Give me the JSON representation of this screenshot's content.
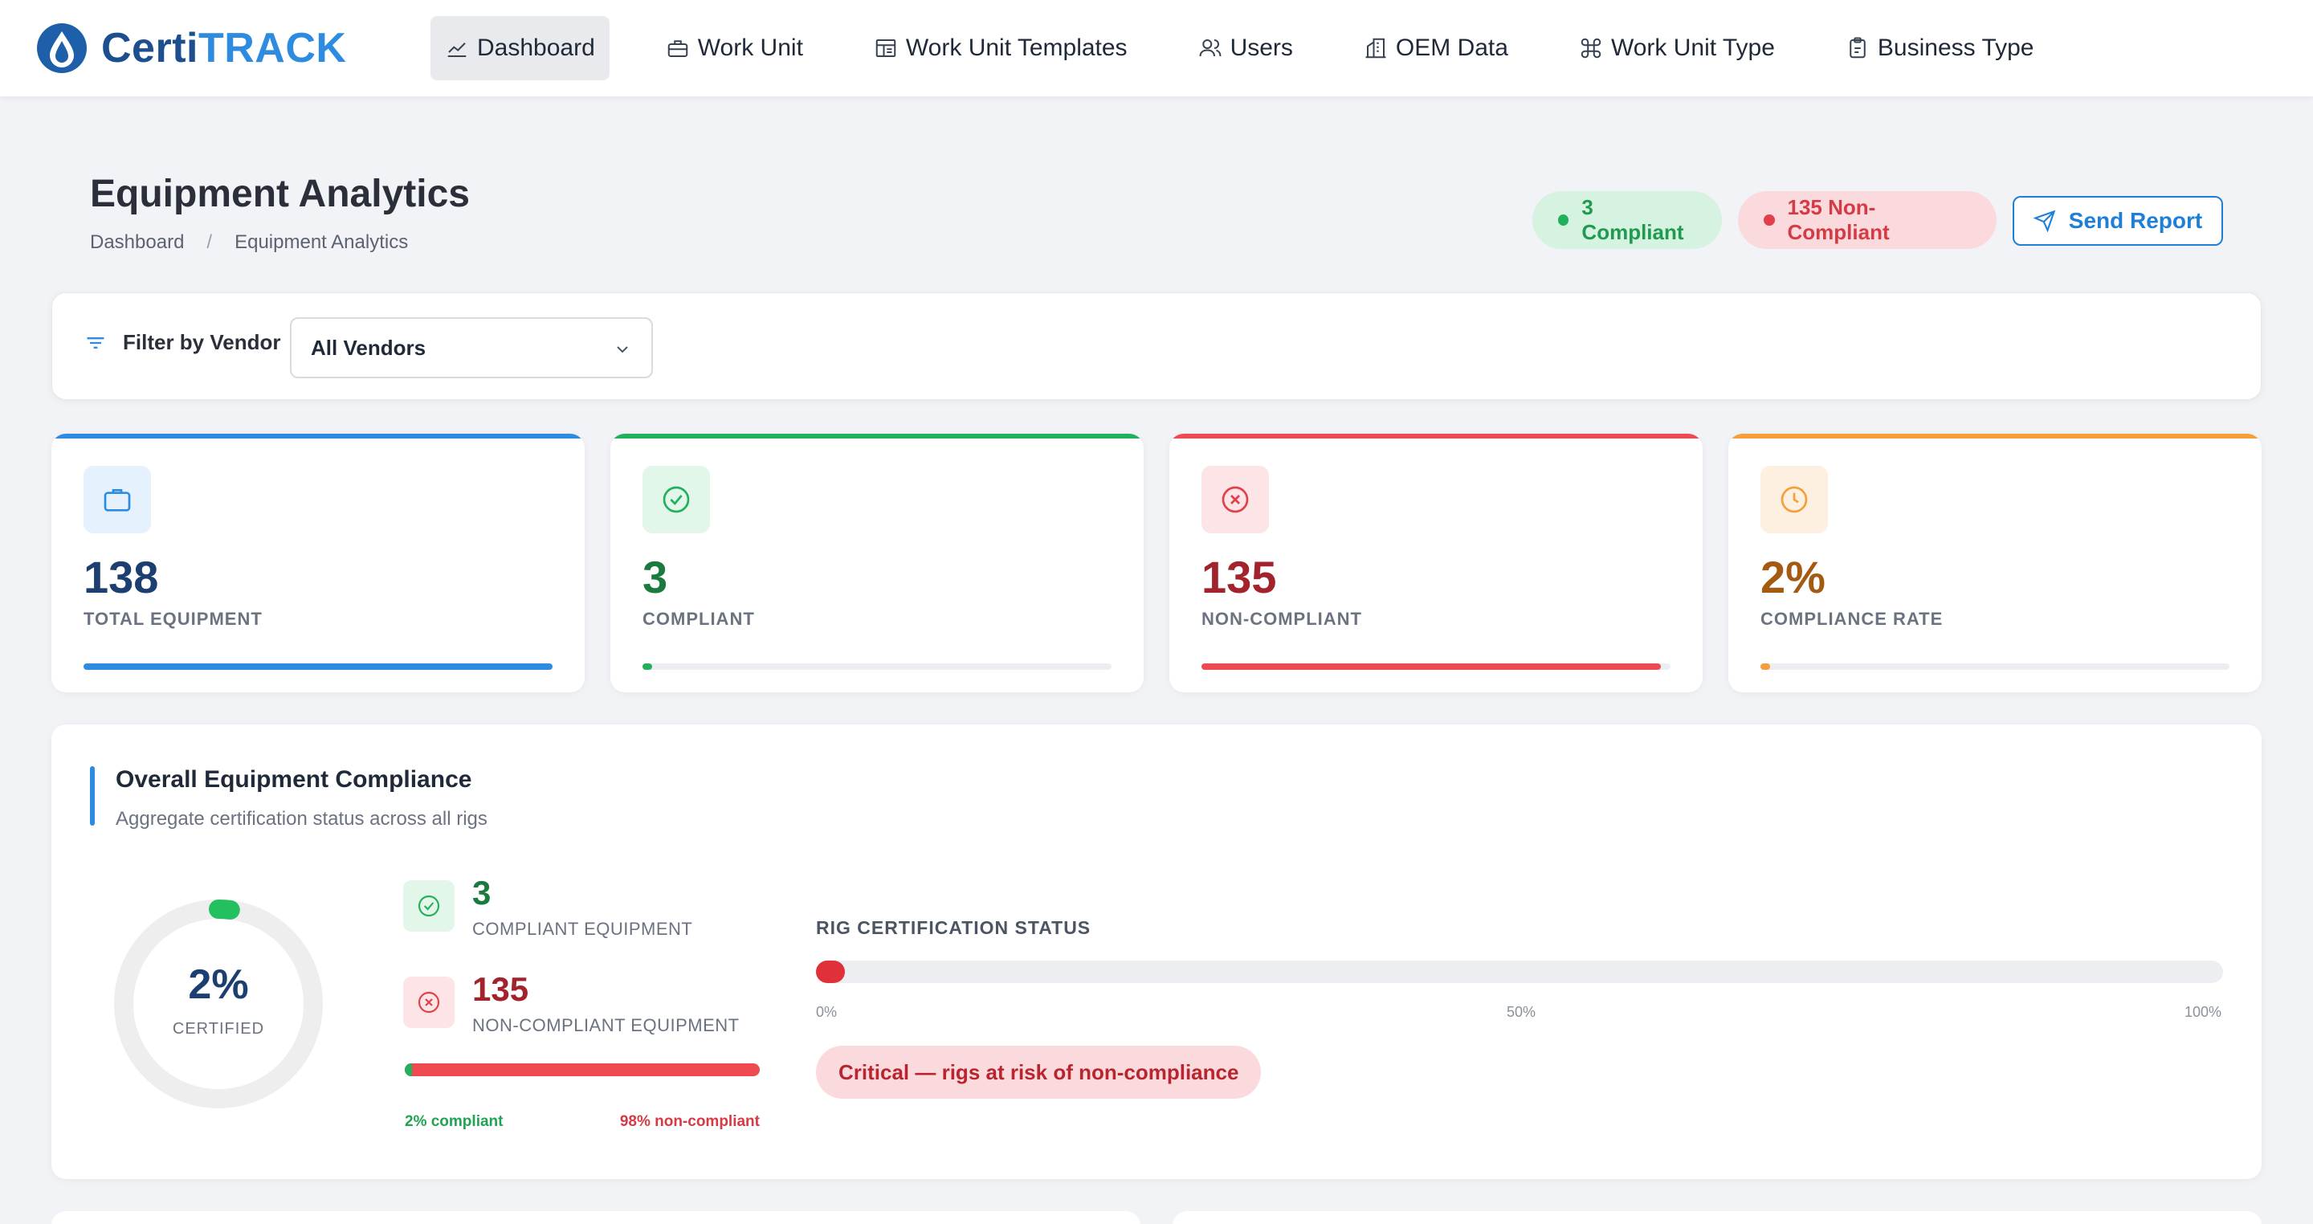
{
  "app": {
    "logo_part1": "Certi",
    "logo_part2": "TRACK"
  },
  "nav": {
    "items": [
      {
        "label": "Dashboard",
        "icon": "chart-line-icon",
        "active": true
      },
      {
        "label": "Work Unit",
        "icon": "toolbox-icon"
      },
      {
        "label": "Work Unit Templates",
        "icon": "template-icon"
      },
      {
        "label": "Users",
        "icon": "users-icon"
      },
      {
        "label": "OEM Data",
        "icon": "building-icon"
      },
      {
        "label": "Work Unit Type",
        "icon": "command-icon"
      },
      {
        "label": "Business Type",
        "icon": "clipboard-icon"
      }
    ]
  },
  "header": {
    "title": "Equipment Analytics",
    "breadcrumb": [
      "Dashboard",
      "Equipment Analytics"
    ],
    "compliant_pill": "3 Compliant",
    "noncompliant_pill": "135 Non-Compliant",
    "send_report": "Send Report"
  },
  "filter": {
    "label": "Filter by Vendor",
    "selected": "All Vendors"
  },
  "stats": [
    {
      "value": "138",
      "label": "TOTAL EQUIPMENT",
      "color": "#2d8ce0",
      "value_color": "#1d3e70",
      "fraction": 1.0,
      "icon": "briefcase-icon"
    },
    {
      "value": "3",
      "label": "COMPLIANT",
      "color": "#22b05c",
      "value_color": "#1b7a3e",
      "fraction": 0.02,
      "icon": "check-circle-icon"
    },
    {
      "value": "135",
      "label": "NON-COMPLIANT",
      "color": "#ef4a52",
      "value_color": "#a3232c",
      "fraction": 0.98,
      "icon": "x-circle-icon"
    },
    {
      "value": "2%",
      "label": "COMPLIANCE RATE",
      "color": "#f59e3b",
      "value_color": "#a55a12",
      "fraction": 0.02,
      "icon": "clock-icon"
    }
  ],
  "overall": {
    "title": "Overall Equipment Compliance",
    "subtitle": "Aggregate certification status across all rigs",
    "donut_value": "2%",
    "donut_label": "CERTIFIED",
    "compliant_fraction": 0.02,
    "compliant_count": "3",
    "compliant_label": "COMPLIANT EQUIPMENT",
    "noncompliant_count": "135",
    "noncompliant_label": "NON-COMPLIANT EQUIPMENT",
    "split_left": "2% compliant",
    "split_right": "98% non-compliant",
    "rig_title": "RIG CERTIFICATION STATUS",
    "rig_ticks": [
      "0%",
      "50%",
      "100%"
    ],
    "rig_fraction": 0.02,
    "critical": "Critical — rigs at risk of non-compliance"
  }
}
